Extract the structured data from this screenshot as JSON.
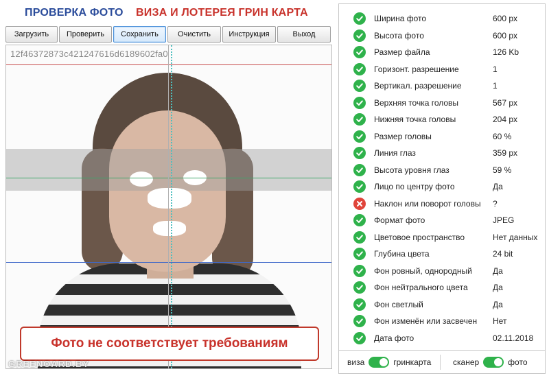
{
  "header": {
    "title_check": "ПРОВЕРКА ФОТО",
    "title_visa": "ВИЗА И ЛОТЕРЕЯ ГРИН КАРТА"
  },
  "toolbar": {
    "buttons": [
      {
        "label": "Загрузить"
      },
      {
        "label": "Проверить"
      },
      {
        "label": "Сохранить",
        "active": true
      },
      {
        "label": "Очистить"
      },
      {
        "label": "Инструкция"
      },
      {
        "label": "Выход"
      }
    ]
  },
  "photo": {
    "hash": "12f46372873c421247616d6189602fa0",
    "alert": "Фото не соответствует требованиям",
    "watermark": "GREENOARD.BY"
  },
  "results": {
    "rows": [
      {
        "label": "Ширина фото",
        "value": "600 px",
        "status": "ok"
      },
      {
        "label": "Высота фото",
        "value": "600 px",
        "status": "ok"
      },
      {
        "label": "Размер файла",
        "value": "126 Kb",
        "status": "ok"
      },
      {
        "label": "Горизонт. разрешение",
        "value": "1",
        "status": "ok"
      },
      {
        "label": "Вертикал. разрешение",
        "value": "1",
        "status": "ok"
      },
      {
        "label": "Верхняя точка головы",
        "value": "567 px",
        "status": "ok"
      },
      {
        "label": "Нижняя точка головы",
        "value": "204 px",
        "status": "ok"
      },
      {
        "label": "Размер головы",
        "value": "60 %",
        "status": "ok"
      },
      {
        "label": "Линия глаз",
        "value": "359 px",
        "status": "ok"
      },
      {
        "label": "Высота уровня глаз",
        "value": "59 %",
        "status": "ok"
      },
      {
        "label": "Лицо по центру фото",
        "value": "Да",
        "status": "ok"
      },
      {
        "label": "Наклон или поворот головы",
        "value": "?",
        "status": "error"
      },
      {
        "label": "Формат фото",
        "value": "JPEG",
        "status": "ok"
      },
      {
        "label": "Цветовое пространство",
        "value": "Нет данных",
        "status": "ok"
      },
      {
        "label": "Глубина цвета",
        "value": "24 bit",
        "status": "ok"
      },
      {
        "label": "Фон ровный, однородный",
        "value": "Да",
        "status": "ok"
      },
      {
        "label": "Фон нейтрального цвета",
        "value": "Да",
        "status": "ok"
      },
      {
        "label": "Фон светлый",
        "value": "Да",
        "status": "ok"
      },
      {
        "label": "Фон изменён или засвечен",
        "value": "Нет",
        "status": "ok"
      },
      {
        "label": "Дата фото",
        "value": "02.11.2018",
        "status": "ok"
      }
    ]
  },
  "toggles": {
    "mode_left": "виза",
    "mode_right": "гринкарта",
    "source_left": "сканер",
    "source_right": "фото",
    "mode_state": "гринкарта",
    "source_state": "фото"
  },
  "colors": {
    "ok": "#2fb24b",
    "error": "#e0443a",
    "title_blue": "#2b4c9b",
    "title_red": "#c8322b"
  }
}
